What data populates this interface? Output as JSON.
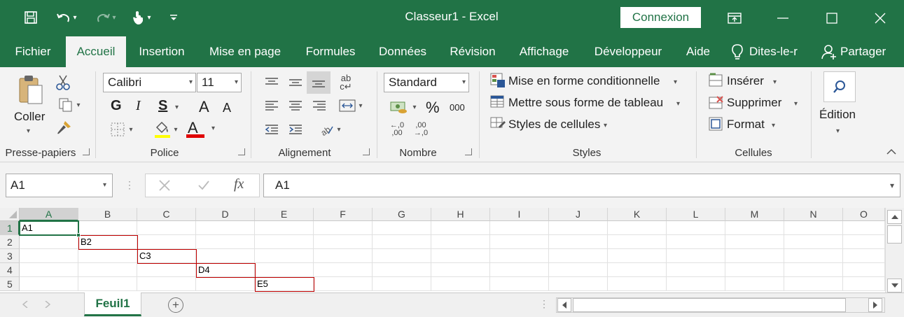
{
  "colors": {
    "accent": "#217346",
    "selection_border": "#217346",
    "red_border": "#c00000"
  },
  "title": {
    "text": "Classeur1  -  Excel",
    "signin_label": "Connexion"
  },
  "qat": {
    "icons": [
      "save-icon",
      "undo-icon",
      "redo-icon",
      "touch-mode-icon",
      "customize-icon"
    ]
  },
  "tabs": [
    "Fichier",
    "Accueil",
    "Insertion",
    "Mise en page",
    "Formules",
    "Données",
    "Révision",
    "Affichage",
    "Développeur",
    "Aide"
  ],
  "tell_me": "Dites-le-r",
  "share_label": "Partager",
  "ribbon": {
    "clipboard": {
      "paste_label": "Coller",
      "group_label": "Presse-papiers"
    },
    "font": {
      "name": "Calibri",
      "size": "11",
      "bold": "G",
      "italic": "I",
      "underline": "S",
      "grow": "A",
      "shrink": "A",
      "color_a": "A",
      "group_label": "Police"
    },
    "alignment": {
      "group_label": "Alignement"
    },
    "number": {
      "format": "Standard",
      "percent": "%",
      "thousands": "000",
      "inc_dec": ",0 ,00",
      "dec_dec": ",00 ,0",
      "group_label": "Nombre"
    },
    "styles": {
      "conditional": "Mise en forme conditionnelle",
      "table": "Mettre sous forme de tableau",
      "cell_styles": "Styles de cellules",
      "group_label": "Styles"
    },
    "cells": {
      "insert": "Insérer",
      "delete": "Supprimer",
      "format": "Format",
      "group_label": "Cellules"
    },
    "editing": {
      "label": "Édition"
    }
  },
  "formula_bar": {
    "name_box": "A1",
    "fx": "fx",
    "content": "A1"
  },
  "grid": {
    "columns": [
      "A",
      "B",
      "C",
      "D",
      "E",
      "F",
      "G",
      "H",
      "I",
      "J",
      "K",
      "L",
      "M",
      "N",
      "O"
    ],
    "rows": [
      "1",
      "2",
      "3",
      "4",
      "5"
    ],
    "cells": [
      {
        "ref": "A1",
        "text": "A1"
      },
      {
        "ref": "B2",
        "text": "B2"
      },
      {
        "ref": "C3",
        "text": "C3"
      },
      {
        "ref": "D4",
        "text": "D4"
      },
      {
        "ref": "E5",
        "text": "E5"
      }
    ],
    "selected": "A1"
  },
  "sheets": {
    "tabs": [
      "Feuil1"
    ],
    "add_label": "+"
  }
}
